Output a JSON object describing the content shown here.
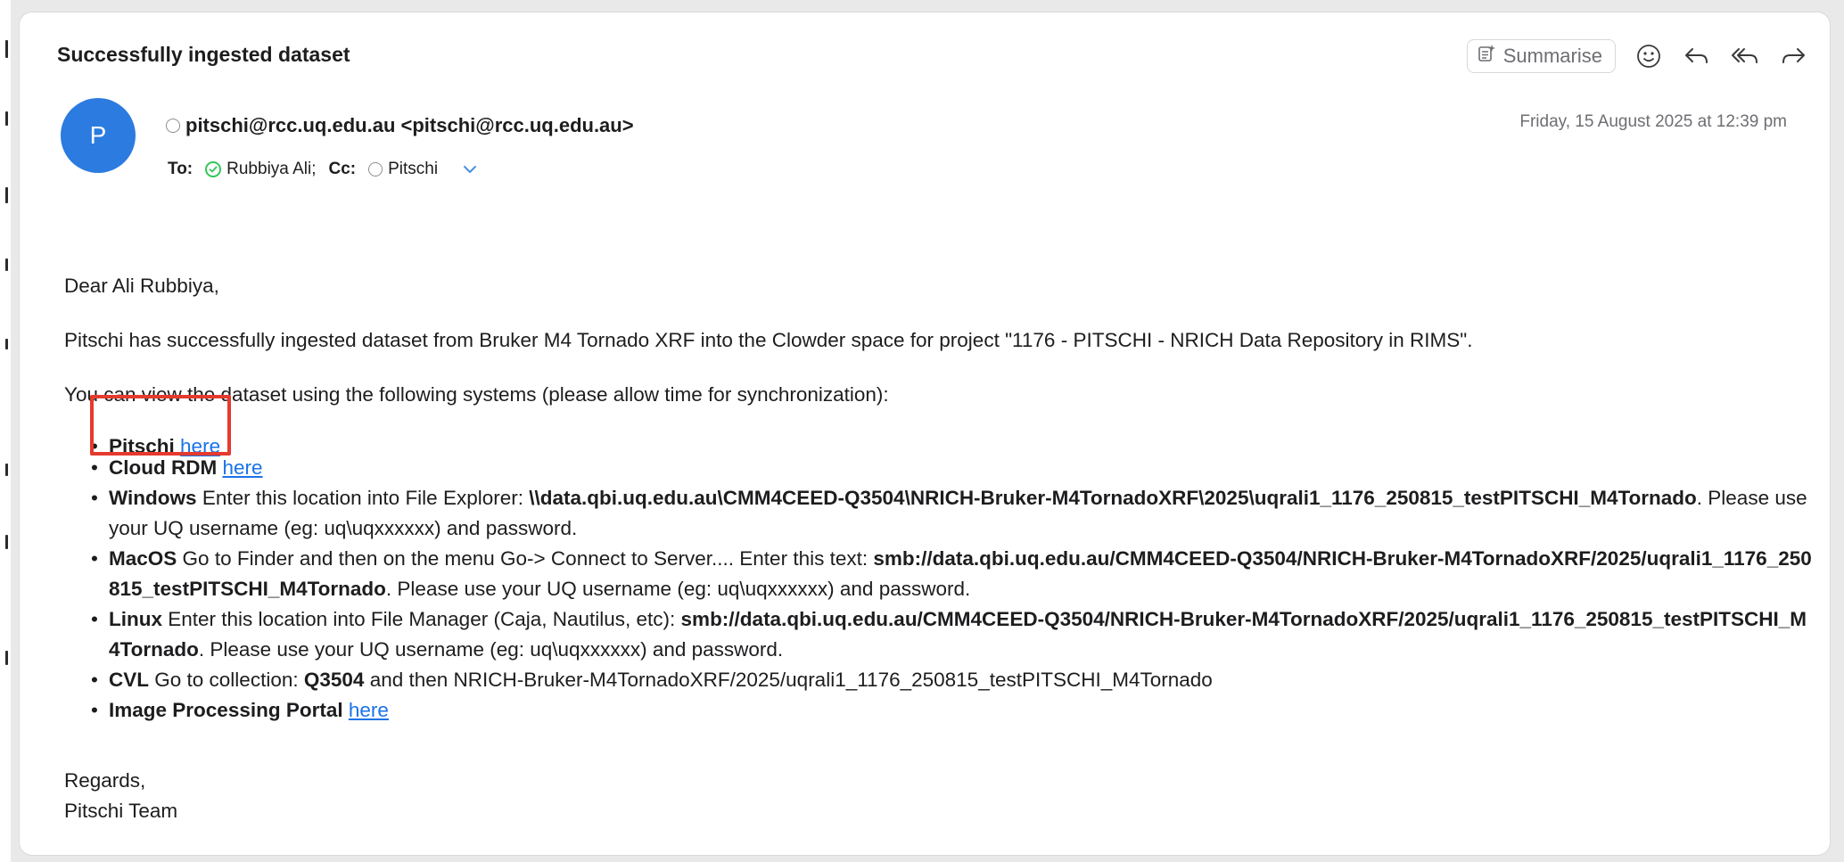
{
  "email": {
    "subject": "Successfully ingested dataset",
    "summarise_label": "Summarise",
    "avatar_initial": "P",
    "from": "pitschi@rcc.uq.edu.au <pitschi@rcc.uq.edu.au>",
    "date": "Friday, 15 August 2025 at 12:39 pm",
    "to_label": "To:",
    "to": "Rubbiya Ali;",
    "cc_label": "Cc:",
    "cc": "Pitschi"
  },
  "body": {
    "greeting": "Dear Ali Rubbiya,",
    "intro": "Pitschi has successfully ingested dataset from Bruker M4 Tornado XRF into the Clowder space for project \"1176 - PITSCHI - NRICH Data Repository in RIMS\".",
    "view_intro": "You can view the dataset using the following systems (please allow time for synchronization):",
    "items": [
      {
        "title": "Pitschi",
        "link": "here"
      },
      {
        "title": "Cloud RDM",
        "link": "here"
      },
      {
        "title": "Windows",
        "text": "Enter this location into File Explorer:",
        "path": "\\\\data.qbi.uq.edu.au\\CMM4CEED-Q3504\\NRICH-Bruker-M4TornadoXRF\\2025\\uqrali1_1176_250815_testPITSCHI_M4Tornado",
        "tail": ". Please use your UQ username (eg: uq\\uqxxxxxx) and password."
      },
      {
        "title": "MacOS",
        "text": "Go to Finder and then on the menu Go-> Connect to Server.... Enter this text:",
        "path": "smb://data.qbi.uq.edu.au/CMM4CEED-Q3504/NRICH-Bruker-M4TornadoXRF/2025/uqrali1_1176_250815_testPITSCHI_M4Tornado",
        "tail": ". Please use your UQ username (eg: uq\\uqxxxxxx) and password."
      },
      {
        "title": "Linux",
        "text": "Enter this location into File Manager (Caja, Nautilus, etc):",
        "path": "smb://data.qbi.uq.edu.au/CMM4CEED-Q3504/NRICH-Bruker-M4TornadoXRF/2025/uqrali1_1176_250815_testPITSCHI_M4Tornado",
        "tail": ". Please use your UQ username (eg: uq\\uqxxxxxx) and password."
      },
      {
        "title": "CVL",
        "text": "Go to collection:",
        "code": "Q3504",
        "tail": "and then NRICH-Bruker-M4TornadoXRF/2025/uqrali1_1176_250815_testPITSCHI_M4Tornado"
      },
      {
        "title": "Image Processing Portal",
        "link": "here"
      }
    ],
    "regards": "Regards,",
    "signature": "Pitschi Team"
  },
  "colors": {
    "highlight": "#e53a2e",
    "avatar": "#2b7be0",
    "link": "#1a73e8",
    "recipient_ok": "#34c759"
  },
  "icons": [
    "summarise-icon",
    "emoji-icon",
    "reply-icon",
    "reply-all-icon",
    "forward-icon",
    "chevron-down-icon",
    "status-ring-icon",
    "check-circle-icon"
  ]
}
